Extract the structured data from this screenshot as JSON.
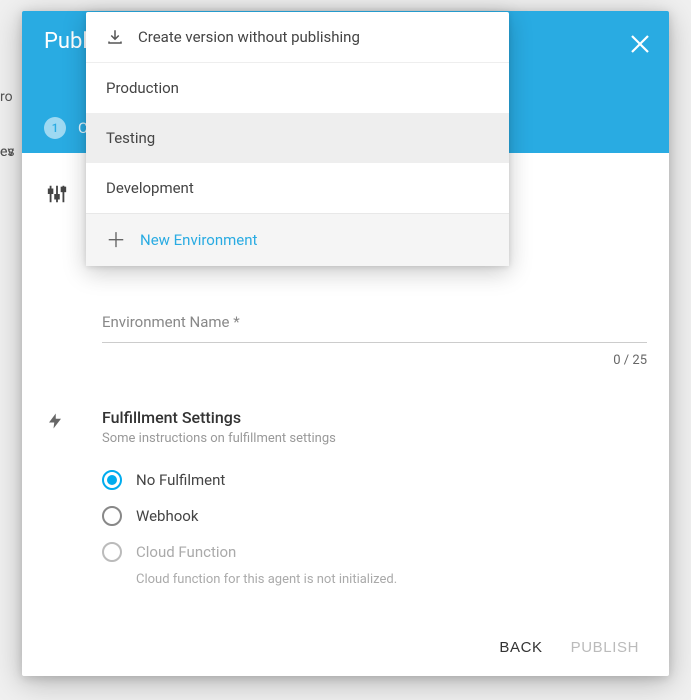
{
  "bg": {
    "a": "ro",
    "b": "es"
  },
  "ev": "ev",
  "modal": {
    "title": "Publish",
    "step": {
      "num": "1",
      "label": "Cre"
    }
  },
  "dropdown": {
    "create_without_publish": "Create version without publishing",
    "envs": [
      "Production",
      "Testing",
      "Development"
    ],
    "new_env": "New Environment"
  },
  "env_field": {
    "label": "Environment Name *",
    "counter": "0 / 25"
  },
  "fulfillment": {
    "title": "Fulfillment Settings",
    "subtitle": "Some instructions on fulfillment settings",
    "options": {
      "none": "No Fulfilment",
      "webhook": "Webhook",
      "cloud": "Cloud Function"
    },
    "cloud_hint": "Cloud function for this agent is not initialized."
  },
  "footer": {
    "back": "BACK",
    "publish": "PUBLISH"
  }
}
